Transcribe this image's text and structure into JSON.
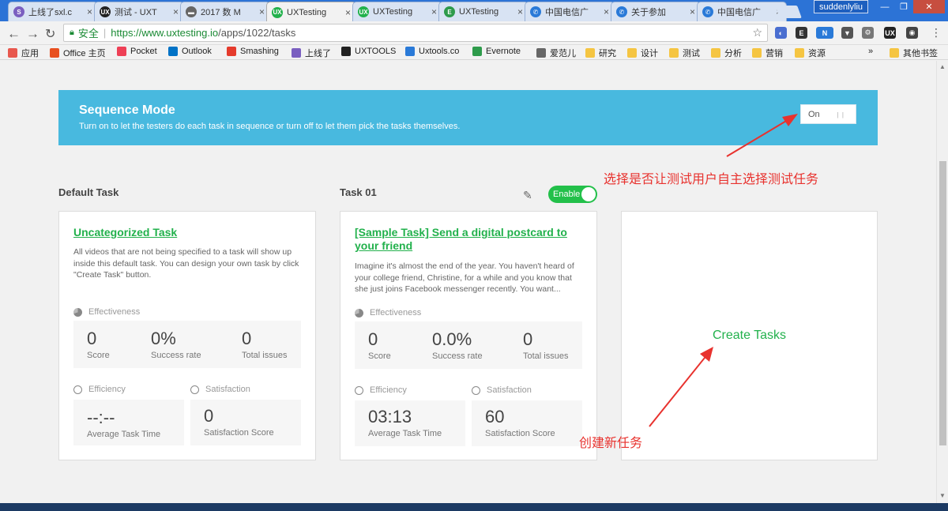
{
  "browser": {
    "tabs": [
      {
        "title": "上线了sxl.c",
        "color": "#7a5fc0",
        "glyph": "S"
      },
      {
        "title": "测试 - UXT",
        "color": "#222222",
        "glyph": "UX"
      },
      {
        "title": "2017 数 M",
        "color": "#666666",
        "glyph": "▬"
      },
      {
        "title": "UXTesting",
        "color": "#22b14c",
        "glyph": "UX"
      },
      {
        "title": "UXTesting",
        "color": "#22b14c",
        "glyph": "UX"
      },
      {
        "title": "UXTesting",
        "color": "#2e9b4b",
        "glyph": "E"
      },
      {
        "title": "中国电信广",
        "color": "#2a7ad8",
        "glyph": "✆"
      },
      {
        "title": "关于参加",
        "color": "#2a7ad8",
        "glyph": "✆"
      },
      {
        "title": "中国电信广",
        "color": "#2a7ad8",
        "glyph": "✆"
      }
    ],
    "user": "suddenlyliu",
    "address": {
      "secure_label": "安全",
      "url_host": "https://www.uxtesting.io",
      "url_path": "/apps/1022/tasks"
    },
    "bookmarks": [
      {
        "label": "应用",
        "color": "#e8584e"
      },
      {
        "label": "Office 主页",
        "color": "#e8501f"
      },
      {
        "label": "Pocket",
        "color": "#ee4056"
      },
      {
        "label": "Outlook",
        "color": "#0072c6"
      },
      {
        "label": "Smashing",
        "color": "#e53b2c"
      },
      {
        "label": "上线了",
        "color": "#7a5fc0"
      },
      {
        "label": "UXTOOLS",
        "color": "#222222"
      },
      {
        "label": "Uxtools.co",
        "color": "#2a7ad8"
      },
      {
        "label": "Evernote",
        "color": "#2e9b4b"
      },
      {
        "label": "爱范儿",
        "color": "#666666"
      },
      {
        "label": "研究",
        "color": "#f5c542"
      },
      {
        "label": "设计",
        "color": "#f5c542"
      },
      {
        "label": "测试",
        "color": "#f5c542"
      },
      {
        "label": "分析",
        "color": "#f5c542"
      },
      {
        "label": "营销",
        "color": "#f5c542"
      },
      {
        "label": "资源",
        "color": "#f5c542"
      }
    ],
    "bookmarks_more": "»",
    "other_bookmarks": "其他书签"
  },
  "sequence": {
    "title": "Sequence Mode",
    "description": "Turn on to let the testers do each task in sequence or turn off to let them pick the tasks themselves.",
    "toggle_label": "On"
  },
  "columns": {
    "default_heading": "Default Task",
    "task_heading": "Task 01",
    "enable_label": "Enable"
  },
  "cards": [
    {
      "title": "Uncategorized Task",
      "description": "All videos that are not being specified to a task will show up inside this default task. You can design your own task by click \"Create Task\" button.",
      "effectiveness_label": "Effectiveness",
      "score": "0",
      "score_label": "Score",
      "success": "0%",
      "success_label": "Success rate",
      "issues": "0",
      "issues_label": "Total issues",
      "efficiency_label": "Efficiency",
      "time": "--:--",
      "time_label": "Average Task Time",
      "satisfaction_label": "Satisfaction",
      "satisfaction": "0",
      "satisfaction_score_label": "Satisfaction Score"
    },
    {
      "title": "[Sample Task] Send a digital postcard to your friend",
      "description": "Imagine it's almost the end of the year. You haven't heard of your college friend, Christine, for a while and you know that she just joins Facebook messenger recently. You want...",
      "effectiveness_label": "Effectiveness",
      "score": "0",
      "score_label": "Score",
      "success": "0.0%",
      "success_label": "Success rate",
      "issues": "0",
      "issues_label": "Total issues",
      "efficiency_label": "Efficiency",
      "time": "03:13",
      "time_label": "Average Task Time",
      "satisfaction_label": "Satisfaction",
      "satisfaction": "60",
      "satisfaction_score_label": "Satisfaction Score"
    }
  ],
  "create_tasks": "Create Tasks",
  "annotations": {
    "toggle_note": "选择是否让测试用户自主选择测试任务",
    "create_note": "创建新任务",
    "color": "#e8322e"
  },
  "colors": {
    "banner": "#48b9df",
    "accent_green": "#22b14c"
  }
}
